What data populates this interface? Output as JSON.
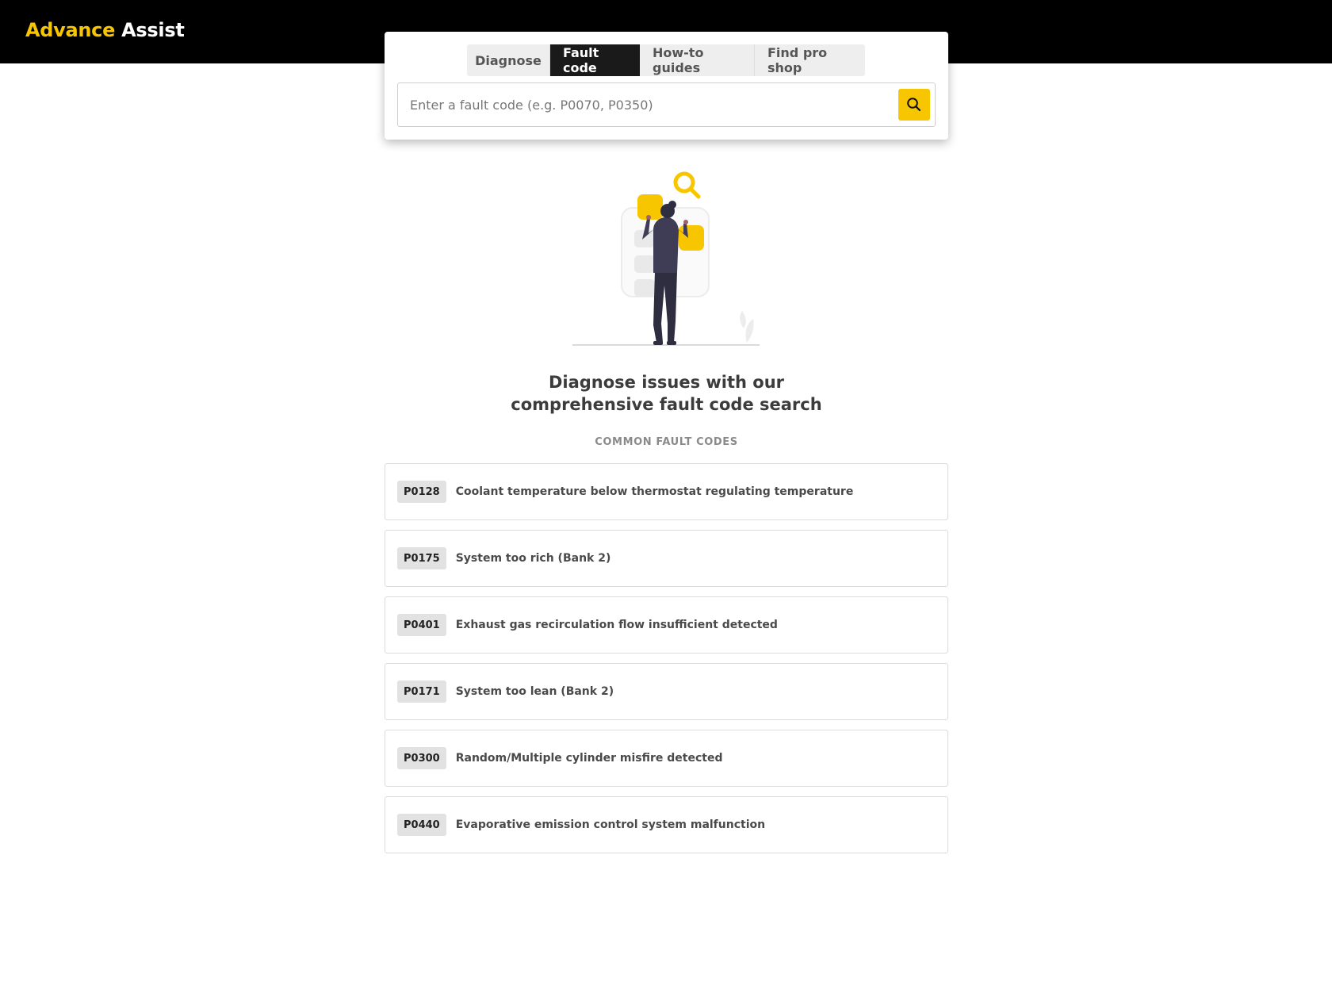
{
  "brand": {
    "part1": "Advance",
    "part2": "Assist"
  },
  "colors": {
    "accent": "#f7c600",
    "header_bg": "#000000",
    "active_tab": "#1a1a1a"
  },
  "tabs": [
    {
      "label": "Diagnose",
      "active": false
    },
    {
      "label": "Fault code",
      "active": true
    },
    {
      "label": "How-to guides",
      "active": false
    },
    {
      "label": "Find pro shop",
      "active": false
    }
  ],
  "search": {
    "placeholder": "Enter a fault code (e.g. P0070, P0350)",
    "value": "",
    "button_icon": "search-icon"
  },
  "hero": {
    "line1": "Diagnose issues with our",
    "line2": "comprehensive fault code search"
  },
  "section_label": "COMMON FAULT CODES",
  "codes": [
    {
      "code": "P0128",
      "description": "Coolant temperature below thermostat regulating temperature"
    },
    {
      "code": "P0175",
      "description": "System too rich (Bank 2)"
    },
    {
      "code": "P0401",
      "description": "Exhaust gas recirculation flow insufficient detected"
    },
    {
      "code": "P0171",
      "description": "System too lean (Bank 2)"
    },
    {
      "code": "P0300",
      "description": "Random/Multiple cylinder misfire detected"
    },
    {
      "code": "P0440",
      "description": "Evaporative emission control system malfunction"
    }
  ]
}
